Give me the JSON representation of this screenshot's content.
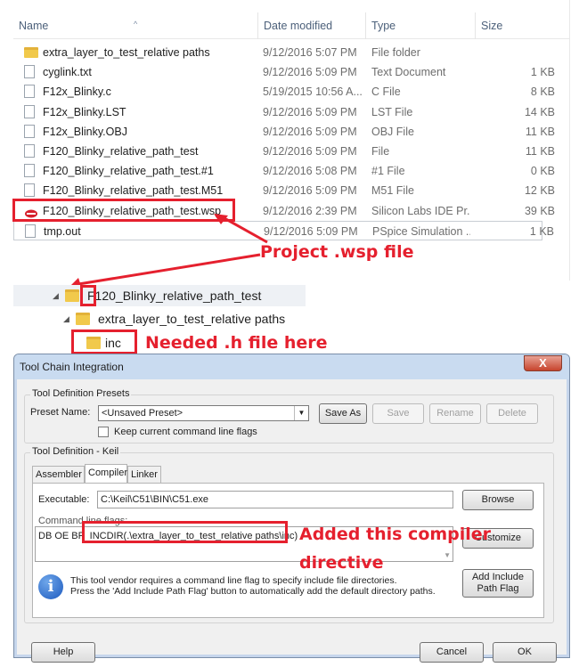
{
  "explorer": {
    "columns": {
      "name": "Name",
      "date": "Date modified",
      "type": "Type",
      "size": "Size"
    },
    "files": [
      {
        "name": "extra_layer_to_test_relative paths",
        "date": "9/12/2016 5:07 PM",
        "type": "File folder",
        "size": "",
        "icon": "folder-icon"
      },
      {
        "name": "cyglink.txt",
        "date": "9/12/2016 5:09 PM",
        "type": "Text Document",
        "size": "1 KB",
        "icon": "text-file-icon"
      },
      {
        "name": "F12x_Blinky.c",
        "date": "5/19/2015 10:56 A...",
        "type": "C File",
        "size": "8 KB",
        "icon": "file-icon"
      },
      {
        "name": "F12x_Blinky.LST",
        "date": "9/12/2016 5:09 PM",
        "type": "LST File",
        "size": "14 KB",
        "icon": "file-icon"
      },
      {
        "name": "F12x_Blinky.OBJ",
        "date": "9/12/2016 5:09 PM",
        "type": "OBJ File",
        "size": "11 KB",
        "icon": "file-icon"
      },
      {
        "name": "F120_Blinky_relative_path_test",
        "date": "9/12/2016 5:09 PM",
        "type": "File",
        "size": "11 KB",
        "icon": "file-icon"
      },
      {
        "name": "F120_Blinky_relative_path_test.#1",
        "date": "9/12/2016 5:08 PM",
        "type": "#1 File",
        "size": "0 KB",
        "icon": "file-icon"
      },
      {
        "name": "F120_Blinky_relative_path_test.M51",
        "date": "9/12/2016 5:09 PM",
        "type": "M51 File",
        "size": "12 KB",
        "icon": "file-icon"
      },
      {
        "name": "F120_Blinky_relative_path_test.wsp",
        "date": "9/12/2016 2:39 PM",
        "type": "Silicon Labs IDE Pr...",
        "size": "39 KB",
        "icon": "silicon-labs-icon"
      },
      {
        "name": "tmp.out",
        "date": "9/12/2016 5:09 PM",
        "type": "PSpice Simulation ...",
        "size": "1 KB",
        "icon": "file-icon"
      }
    ]
  },
  "annotations": {
    "project_wsp": "Project .wsp file",
    "needed_h": "Needed .h file here",
    "added_directive_1": "Added this compiler",
    "added_directive_2": "directive"
  },
  "tree": {
    "root": "F120_Blinky_relative_path_test",
    "child": "extra_layer_to_test_relative paths",
    "grandchild": "inc"
  },
  "dialog": {
    "title": "Tool Chain Integration",
    "close": "X",
    "presets_group": "Tool Definition Presets",
    "preset_name_label": "Preset Name:",
    "preset_value": "<Unsaved Preset>",
    "save_as": "Save As",
    "save": "Save",
    "rename": "Rename",
    "delete": "Delete",
    "keep_flags": "Keep current command line flags",
    "tooldef_group": "Tool Definition - Keil",
    "tabs": [
      "Assembler",
      "Compiler",
      "Linker"
    ],
    "executable_label": "Executable:",
    "executable_value": "C:\\Keil\\C51\\BIN\\C51.exe",
    "browse": "Browse",
    "cmdline_label": "Command line flags:",
    "cmdline_prefix": "DB OE BR",
    "cmdline_incdir": "INCDIR(.\\extra_layer_to_test_relative paths\\inc)",
    "customize": "Customize",
    "info_line1": "This tool vendor requires a command line flag to specify include file directories.",
    "info_line2": "Press the 'Add Include Path Flag' button to automatically add the default directory paths.",
    "add_include_1": "Add Include",
    "add_include_2": "Path Flag",
    "help": "Help",
    "cancel": "Cancel",
    "ok": "OK"
  },
  "colors": {
    "annotation": "#e5202e",
    "folder": "#f1c94b"
  }
}
